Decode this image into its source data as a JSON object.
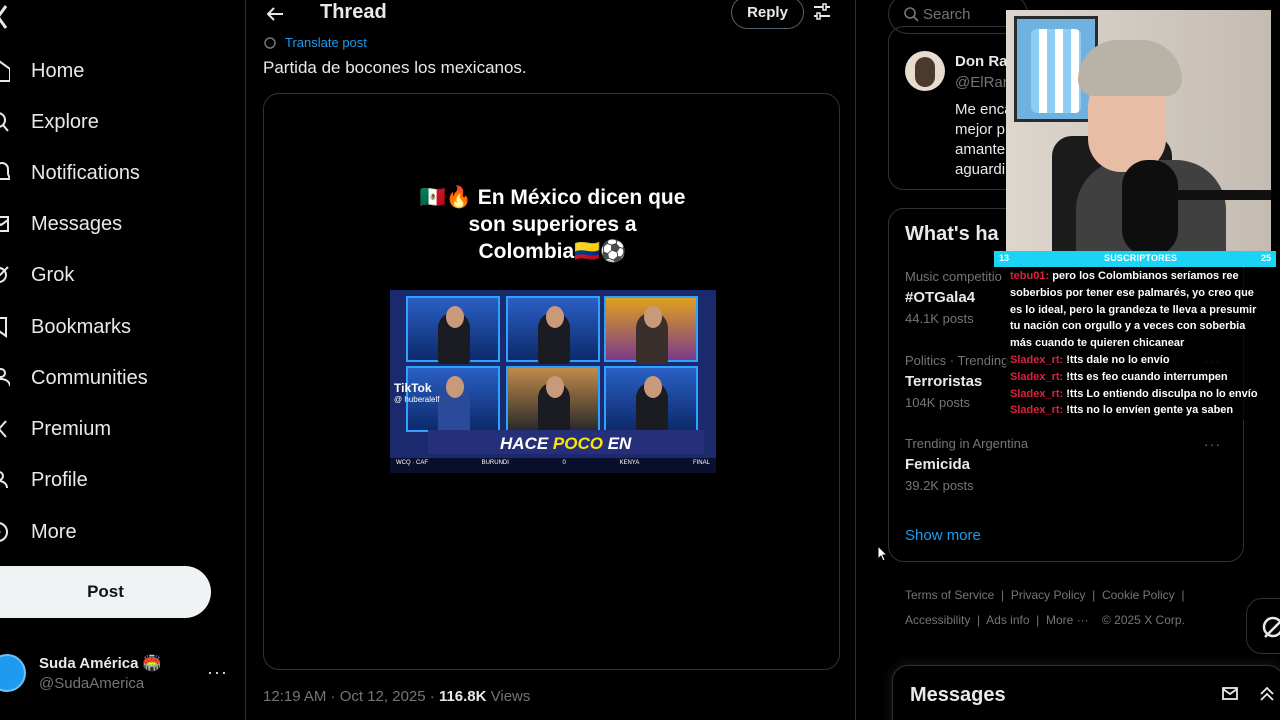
{
  "nav": {
    "items": [
      {
        "label": "Home"
      },
      {
        "label": "Explore"
      },
      {
        "label": "Notifications"
      },
      {
        "label": "Messages"
      },
      {
        "label": "Grok"
      },
      {
        "label": "Bookmarks"
      },
      {
        "label": "Communities"
      },
      {
        "label": "Premium"
      },
      {
        "label": "Profile"
      },
      {
        "label": "More"
      }
    ],
    "post_label": "Post",
    "account": {
      "name": "Suda América 🏟️",
      "handle": "@SudaAmerica",
      "more": "···"
    }
  },
  "header": {
    "title": "Thread",
    "reply_label": "Reply"
  },
  "tweet": {
    "translate": "Translate post",
    "text": "Partida de bocones los mexicanos.",
    "media": {
      "caption_line1": "🇲🇽🔥 En México dicen que",
      "caption_line2": "son superiores a",
      "caption_line3": "Colombia🇨🇴⚽",
      "tiktok": "TikTok",
      "tiktok_handle": "@ huberalelf",
      "hace": "HACE",
      "poco": "POCO",
      "en": "EN",
      "ticker_left": "WCQ · CAF",
      "ticker_mid1": "BURUNDI",
      "ticker_score": "0",
      "ticker_mid2": "KENYA",
      "ticker_final": "FINAL"
    },
    "time": "12:19 AM · Oct 12, 2025 · ",
    "views_count": "116.8K",
    "views_label": " Views"
  },
  "search": {
    "placeholder": "Search"
  },
  "card1": {
    "name": "Don Ra",
    "handle": "@ElRan",
    "line1": "Me enca",
    "line2": "mejor p",
    "line3": "amante",
    "line4": "aguardi"
  },
  "trends": {
    "title": "What's ha",
    "items": [
      {
        "category": "Music competitio",
        "name": "#OTGala4",
        "count": "44.1K posts"
      },
      {
        "category": "Politics · Trending",
        "name": "Terroristas",
        "count": "104K posts"
      },
      {
        "category": "Trending in Argentina",
        "name": "Femicida",
        "count": "39.2K posts"
      }
    ],
    "more_dots": "···",
    "show_more": "Show more"
  },
  "footer": {
    "line1": [
      "Terms of Service",
      "Privacy Policy",
      "Cookie Policy"
    ],
    "line2": [
      "Accessibility",
      "Ads info",
      "More ···",
      "© 2025 X Corp."
    ]
  },
  "messages_drawer": {
    "title": "Messages"
  },
  "overlay": {
    "sub_left": "13",
    "sub_mid": "SUSCRIPTORES",
    "sub_right": "25",
    "chat": [
      {
        "user": "tebu01:",
        "text": "pero los Colombianos seríamos ree"
      },
      {
        "user": "",
        "text": "soberbios por tener ese palmarés, yo creo que"
      },
      {
        "user": "",
        "text": "es lo ideal, pero la grandeza te lleva a presumir"
      },
      {
        "user": "",
        "text": "tu nación con orgullo y a veces con soberbia"
      },
      {
        "user": "",
        "text": "más cuando te quieren chicanear"
      },
      {
        "user": "Sladex_rt:",
        "text": "!tts dale no lo envío"
      },
      {
        "user": "Sladex_rt:",
        "text": "!tts es feo cuando interrumpen"
      },
      {
        "user": "Sladex_rt:",
        "text": "!tts Lo entiendo disculpa no lo envío"
      },
      {
        "user": "Sladex_rt:",
        "text": "!tts no lo envíen gente ya saben"
      }
    ]
  },
  "colors": {
    "accent": "#1d9bf0",
    "border": "#2f3336",
    "muted": "#71767b",
    "chat_user": "#e01f3d",
    "sub_bar": "#1ad3f5"
  }
}
